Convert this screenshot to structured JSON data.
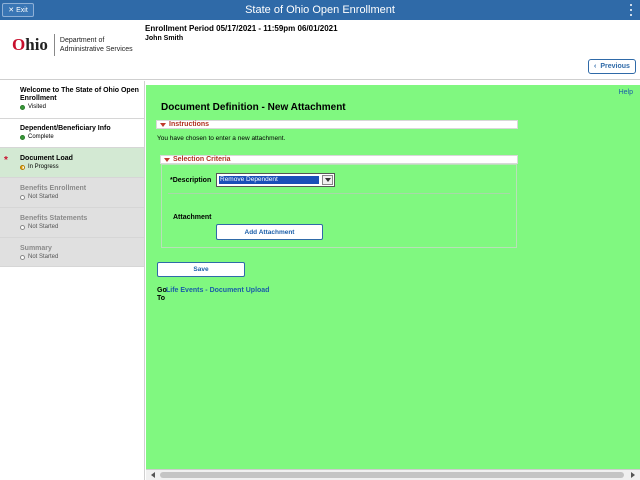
{
  "banner": {
    "exit_label": "Exit",
    "title": "State of Ohio Open Enrollment"
  },
  "header": {
    "logo_text": "Ohio",
    "department_line1": "Department of",
    "department_line2": "Administrative Services",
    "enrollment_period": "Enrollment Period 05/17/2021 - 11:59pm 06/01/2021",
    "user_name": "John Smith",
    "previous_label": "Previous"
  },
  "sidebar": {
    "steps": [
      {
        "label": "Welcome to The State of Ohio Open Enrollment",
        "status": "Visited"
      },
      {
        "label": "Dependent/Beneficiary Info",
        "status": "Complete"
      },
      {
        "label": "Document Load",
        "status": "In Progress"
      },
      {
        "label": "Benefits Enrollment",
        "status": "Not Started"
      },
      {
        "label": "Benefits Statements",
        "status": "Not Started"
      },
      {
        "label": "Summary",
        "status": "Not Started"
      }
    ]
  },
  "main": {
    "help_label": "Help",
    "page_title": "Document Definition - New Attachment",
    "instructions_title": "Instructions",
    "instructions_text": "You have chosen to enter a new attachment.",
    "criteria_title": "Selection Criteria",
    "description_label": "*Description",
    "description_value": "Remove Dependent",
    "attachment_label": "Attachment",
    "add_attachment_label": "Add Attachment",
    "save_label": "Save",
    "goto_label_1": "Go",
    "goto_label_2": "To",
    "goto_link": "Life Events - Document Upload"
  },
  "colors": {
    "banner": "#2f6aa8",
    "main_bg": "#80f880",
    "section_title": "#b03020",
    "link": "#1a5ea8"
  }
}
